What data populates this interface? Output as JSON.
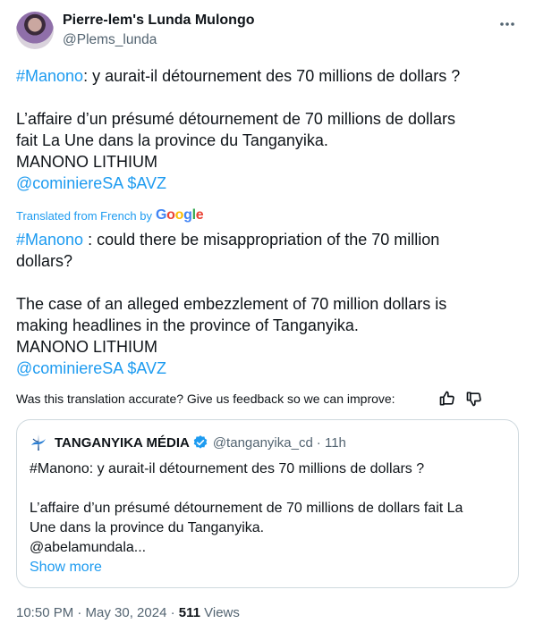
{
  "author": {
    "name": "Pierre-lem's Lunda Mulongo",
    "handle": "@Plems_lunda"
  },
  "original": {
    "line1_hashtag": "#Manono",
    "line1_rest": ": y aurait-il détournement des 70 millions de dollars ?",
    "para2_line1": "L’affaire d’un présumé détournement de 70 millions de dollars",
    "para2_line2": "fait La Une dans la province du Tanganyika.",
    "line_caps": "MANONO LITHIUM",
    "mention": "@cominiereSA",
    "cashtag": "$AVZ"
  },
  "translation": {
    "translated_from": "Translated from French by",
    "hashtag": "#Manono",
    "line1_rest": " : could there be misappropriation of the 70 million",
    "line1_cont": "dollars?",
    "para2_line1": "The case of an alleged embezzlement of 70 million dollars is",
    "para2_line2": "making headlines in the province of Tanganyika.",
    "line_caps": "MANONO LITHIUM",
    "mention": "@cominiereSA",
    "cashtag": "$AVZ"
  },
  "feedback": {
    "question": "Was this translation accurate? Give us feedback so we can improve:"
  },
  "quote": {
    "name": "TANGANYIKA MÉDIA",
    "handle": "@tanganyika_cd",
    "time": "· 11h",
    "line1": "#Manono: y aurait-il détournement des 70 millions de dollars ?",
    "para2_line1": "L’affaire d’un présumé détournement de 70 millions de dollars fait La",
    "para2_line2": "Une dans la province du Tanganyika.",
    "line_mention": "@abelamundala...",
    "show_more": "Show more"
  },
  "meta": {
    "timestamp": "10:50 PM · May 30, 2024 · ",
    "views_count": "511",
    "views_label": " Views"
  },
  "colors": {
    "link": "#1d9bf0",
    "text": "#0f1419",
    "secondary": "#536471",
    "border": "#cfd9de"
  }
}
